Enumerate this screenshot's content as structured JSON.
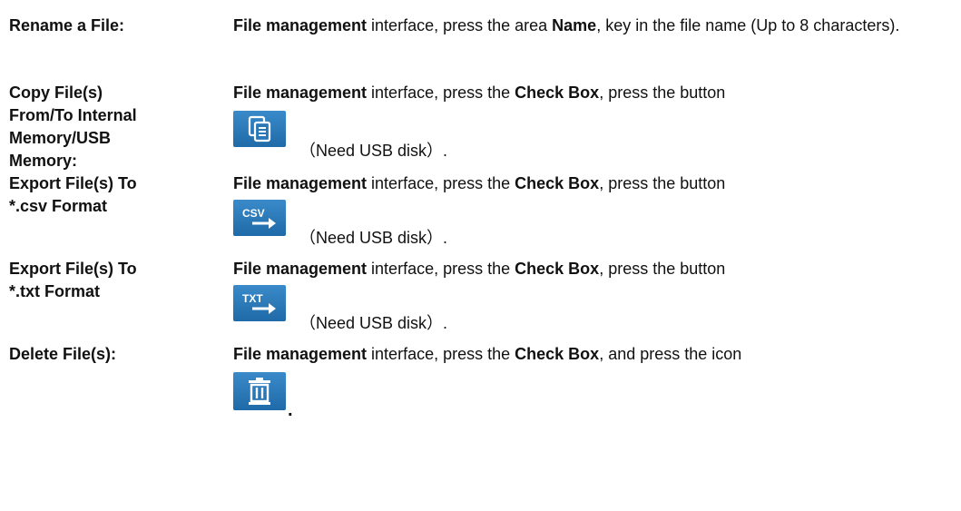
{
  "rows": [
    {
      "term": "Rename a File:",
      "desc": {
        "a": "File management",
        "b": " interface, press the area ",
        "c": "Name",
        "d": ", key in the file name (Up to 8 characters)."
      }
    },
    {
      "term": "Copy File(s)\nFrom/To Internal\nMemory/USB\nMemory:",
      "desc": {
        "a": "File management",
        "b": " interface, press the ",
        "c": "Check Box",
        "d": ", press the button"
      },
      "icon": "copy-file-icon",
      "note": "（Need USB disk）."
    },
    {
      "term": "Export File(s) To\n*.csv Format",
      "desc": {
        "a": "File management",
        "b": " interface, press the ",
        "c": "Check Box",
        "d": ", press the button"
      },
      "icon": "export-csv-icon",
      "icon_label": "CSV",
      "note": "（Need USB disk）."
    },
    {
      "term": "Export File(s) To\n*.txt Format",
      "desc": {
        "a": "File management",
        "b": " interface, press the ",
        "c": "Check Box",
        "d": ", press the button"
      },
      "icon": "export-txt-icon",
      "icon_label": "TXT",
      "note": "（Need USB disk）."
    },
    {
      "term": "Delete File(s):",
      "desc": {
        "a": "File management",
        "b": " interface, press the ",
        "c": "Check Box",
        "d": ", and press the icon"
      },
      "icon": "trash-icon",
      "trailing": "."
    }
  ],
  "colors": {
    "icon_bg": "#2a78b8",
    "icon_fg": "#ffffff"
  }
}
